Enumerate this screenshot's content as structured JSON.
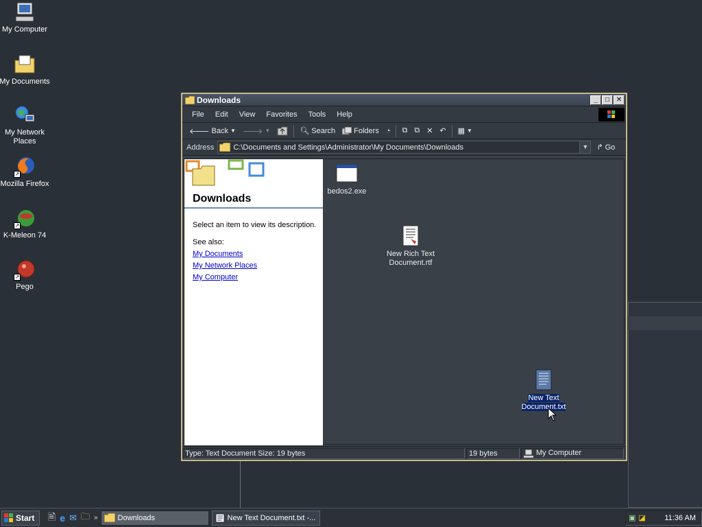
{
  "desktop": {
    "icons": [
      {
        "label": "My Computer"
      },
      {
        "label": "My Documents"
      },
      {
        "label": "My Network Places"
      },
      {
        "label": "Mozilla Firefox"
      },
      {
        "label": "K-Meleon 74"
      },
      {
        "label": "Pego"
      }
    ]
  },
  "window": {
    "title": "Downloads",
    "menu": [
      "File",
      "Edit",
      "View",
      "Favorites",
      "Tools",
      "Help"
    ],
    "toolbar": {
      "back": "Back",
      "search": "Search",
      "folders": "Folders"
    },
    "address": {
      "label": "Address",
      "value": "C:\\Documents and Settings\\Administrator\\My Documents\\Downloads",
      "go": "Go"
    },
    "taskpane": {
      "title": "Downloads",
      "description": "Select an item to view its description.",
      "see_also": "See also:",
      "links": [
        "My Documents",
        "My Network Places",
        "My Computer"
      ]
    },
    "files": [
      {
        "name": "bedos2.exe",
        "selected": false
      },
      {
        "name": "New Rich Text Document.rtf",
        "selected": false
      },
      {
        "name": "New Text Document.txt",
        "selected": true
      }
    ],
    "status": {
      "main": "Type: Text Document Size: 19 bytes",
      "size": "19 bytes",
      "zone": "My Computer"
    }
  },
  "taskbar": {
    "start": "Start",
    "tasks": [
      {
        "label": "Downloads",
        "active": true
      },
      {
        "label": "New Text Document.txt -...",
        "active": false
      }
    ],
    "clock": "11:36 AM"
  },
  "colors": {
    "selection": "#0a246a",
    "link": "#0000cc",
    "window_border": "#c9b98a"
  }
}
